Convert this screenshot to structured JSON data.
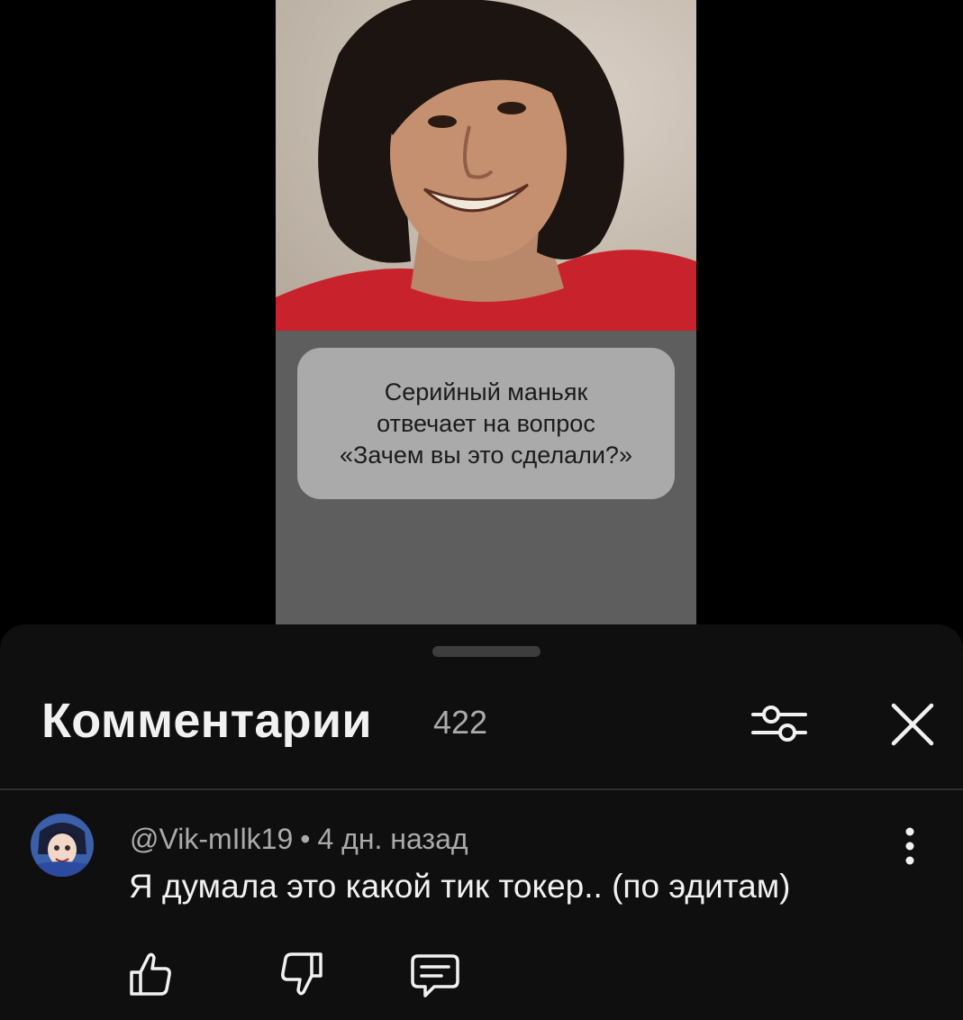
{
  "video": {
    "caption": "Серийный маньяк\nотвечает на вопрос\n«Зачем вы это сделали?»"
  },
  "comments_panel": {
    "title": "Комментарии",
    "count": "422",
    "filter_icon": "sliders-icon",
    "close_icon": "close-icon"
  },
  "comment": {
    "author": "@Vik-mIlk19",
    "separator": "•",
    "time": "4 дн. назад",
    "text": "Я думала это какой тик токер.. (по эдитам)",
    "icons": {
      "more": "more-vertical-icon",
      "like": "thumbs-up-icon",
      "dislike": "thumbs-down-icon",
      "reply": "reply-icon"
    }
  }
}
